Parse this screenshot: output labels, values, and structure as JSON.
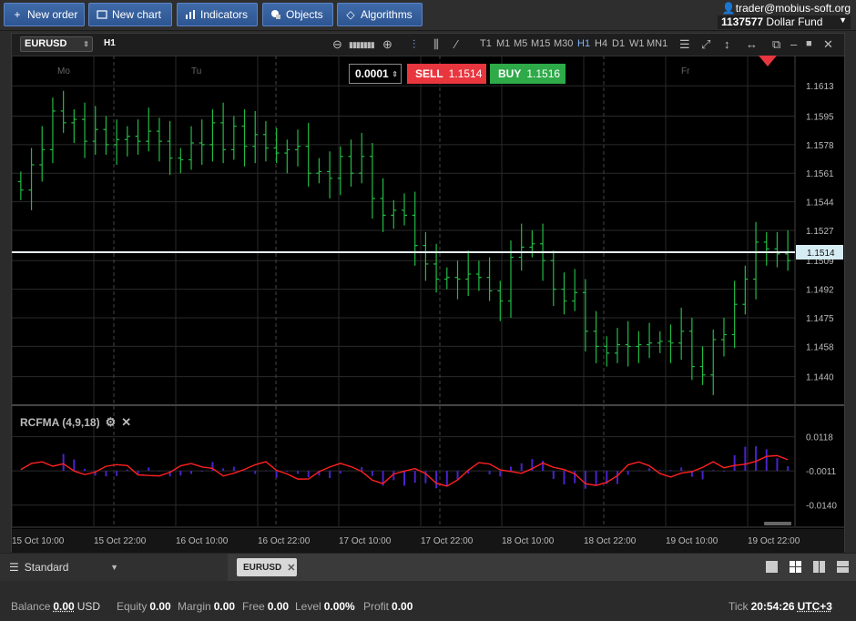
{
  "toolbar": {
    "buttons": [
      {
        "label": "New order",
        "icon": "plus-icon"
      },
      {
        "label": "New chart",
        "icon": "chart-icon"
      },
      {
        "label": "Indicators",
        "icon": "bar-chart-icon"
      },
      {
        "label": "Objects",
        "icon": "shapes-icon"
      },
      {
        "label": "Algorithms",
        "icon": "diamond-icon"
      }
    ]
  },
  "account": {
    "user": "trader@mobius-soft.org",
    "number": "1137577",
    "name": "Dollar Fund"
  },
  "chart": {
    "symbol": "EURUSD",
    "period": "H1",
    "timeframes": [
      "T1",
      "M1",
      "M5",
      "M15",
      "M30",
      "H1",
      "H4",
      "D1",
      "W1",
      "MN1"
    ],
    "active_timeframe": "H1",
    "quantity": "0.0001",
    "sell_label": "SELL",
    "sell_price": "1.1514",
    "buy_label": "BUY",
    "buy_price": "1.1516",
    "current_price": "1.1514",
    "days": [
      "Mo",
      "Tu",
      "Fr"
    ],
    "price_ticks": [
      "1.1613",
      "1.1595",
      "1.1578",
      "1.1561",
      "1.1544",
      "1.1527",
      "1.1509",
      "1.1492",
      "1.1475",
      "1.1458",
      "1.1440"
    ],
    "time_ticks": [
      "15 Oct 10:00",
      "15 Oct 22:00",
      "16 Oct 10:00",
      "16 Oct 22:00",
      "17 Oct 10:00",
      "17 Oct 22:00",
      "18 Oct 10:00",
      "18 Oct 22:00",
      "19 Oct 10:00",
      "19 Oct 22:00"
    ],
    "colors": {
      "up": "#22bb44",
      "line": "#ff2020",
      "hist": "#4a22cc",
      "sell": "#e8363f",
      "buy": "#2eaa49"
    }
  },
  "indicator": {
    "label": "RCFMA (4,9,18)",
    "ticks": [
      "0.0118",
      "-0.0011",
      "-0.0140"
    ]
  },
  "chart_data": {
    "type": "line",
    "title": "",
    "price_range": [
      1.1423,
      1.1631
    ],
    "close_prices": [
      1.1551,
      1.1566,
      1.1575,
      1.1598,
      1.1591,
      1.1593,
      1.158,
      1.1587,
      1.1578,
      1.1581,
      1.1583,
      1.158,
      1.1586,
      1.158,
      1.157,
      1.1569,
      1.1579,
      1.1578,
      1.1591,
      1.1575,
      1.1589,
      1.1577,
      1.1584,
      1.1576,
      1.1573,
      1.1575,
      1.1577,
      1.1561,
      1.1562,
      1.1558,
      1.1571,
      1.1561,
      1.1571,
      1.1546,
      1.1536,
      1.1539,
      1.1536,
      1.1518,
      1.1507,
      1.1498,
      1.1499,
      1.1498,
      1.1501,
      1.1499,
      1.1491,
      1.1485,
      1.1511,
      1.1517,
      1.1519,
      1.1509,
      1.1492,
      1.1485,
      1.149,
      1.1467,
      1.1458,
      1.1454,
      1.1459,
      1.1458,
      1.1459,
      1.146,
      1.1461,
      1.146,
      1.1467,
      1.1446,
      1.1441,
      1.1462,
      1.1465,
      1.1483,
      1.1498,
      1.152,
      1.1516,
      1.1513,
      1.1509
    ],
    "indicator_range": [
      -0.022,
      0.023
    ]
  },
  "workspace": {
    "name": "Standard"
  },
  "tabs": [
    {
      "label": "EURUSD"
    }
  ],
  "status": {
    "balance_label": "Balance",
    "balance": "0.00",
    "currency": "USD",
    "equity_label": "Equity",
    "equity": "0.00",
    "margin_label": "Margin",
    "margin": "0.00",
    "free_label": "Free",
    "free": "0.00",
    "level_label": "Level",
    "level": "0.00%",
    "profit_label": "Profit",
    "profit": "0.00",
    "tick_label": "Tick",
    "time": "20:54:26",
    "tz": "UTC+3"
  }
}
